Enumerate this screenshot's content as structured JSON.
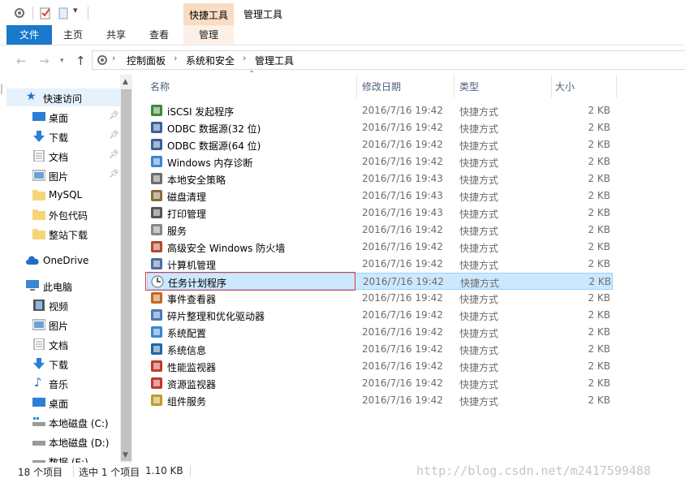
{
  "title_bar": {
    "contextual_tab_label": "快捷工具",
    "window_title": "管理工具"
  },
  "ribbon": {
    "tabs": [
      {
        "label": "文件",
        "active": true
      },
      {
        "label": "主页"
      },
      {
        "label": "共享"
      },
      {
        "label": "查看"
      },
      {
        "label": "管理"
      }
    ]
  },
  "address": {
    "breadcrumbs": [
      "控制面板",
      "系统和安全",
      "管理工具"
    ]
  },
  "nav_pane": {
    "items": [
      {
        "label": "快速访问",
        "icon": "star-icon"
      },
      {
        "label": "桌面",
        "icon": "desktop-icon",
        "pinned": true
      },
      {
        "label": "下载",
        "icon": "download-icon",
        "pinned": true
      },
      {
        "label": "文档",
        "icon": "documents-icon",
        "pinned": true
      },
      {
        "label": "图片",
        "icon": "pictures-icon",
        "pinned": true
      },
      {
        "label": "MySQL",
        "icon": "folder-icon"
      },
      {
        "label": "外包代码",
        "icon": "folder-icon"
      },
      {
        "label": "整站下载",
        "icon": "folder-icon"
      },
      {
        "label": "OneDrive",
        "icon": "cloud-icon"
      },
      {
        "label": "此电脑",
        "icon": "computer-icon"
      },
      {
        "label": "视频",
        "icon": "videos-icon"
      },
      {
        "label": "图片",
        "icon": "pictures-icon"
      },
      {
        "label": "文档",
        "icon": "documents-icon"
      },
      {
        "label": "下载",
        "icon": "download-icon"
      },
      {
        "label": "音乐",
        "icon": "music-icon"
      },
      {
        "label": "桌面",
        "icon": "desktop-icon"
      },
      {
        "label": "本地磁盘 (C:)",
        "icon": "drive-c-icon"
      },
      {
        "label": "本地磁盘 (D:)",
        "icon": "drive-icon"
      },
      {
        "label": "数据 (E:)",
        "icon": "drive-icon"
      }
    ]
  },
  "columns": {
    "name": "名称",
    "modified": "修改日期",
    "type": "类型",
    "size": "大小"
  },
  "files": [
    {
      "name": "iSCSI 发起程序",
      "date": "2016/7/16 19:42",
      "type": "快捷方式",
      "size": "2 KB"
    },
    {
      "name": "ODBC 数据源(32 位)",
      "date": "2016/7/16 19:42",
      "type": "快捷方式",
      "size": "2 KB"
    },
    {
      "name": "ODBC 数据源(64 位)",
      "date": "2016/7/16 19:42",
      "type": "快捷方式",
      "size": "2 KB"
    },
    {
      "name": "Windows 内存诊断",
      "date": "2016/7/16 19:42",
      "type": "快捷方式",
      "size": "2 KB"
    },
    {
      "name": "本地安全策略",
      "date": "2016/7/16 19:43",
      "type": "快捷方式",
      "size": "2 KB"
    },
    {
      "name": "磁盘清理",
      "date": "2016/7/16 19:43",
      "type": "快捷方式",
      "size": "2 KB"
    },
    {
      "name": "打印管理",
      "date": "2016/7/16 19:43",
      "type": "快捷方式",
      "size": "2 KB"
    },
    {
      "name": "服务",
      "date": "2016/7/16 19:42",
      "type": "快捷方式",
      "size": "2 KB"
    },
    {
      "name": "高级安全 Windows 防火墙",
      "date": "2016/7/16 19:42",
      "type": "快捷方式",
      "size": "2 KB"
    },
    {
      "name": "计算机管理",
      "date": "2016/7/16 19:42",
      "type": "快捷方式",
      "size": "2 KB"
    },
    {
      "name": "任务计划程序",
      "date": "2016/7/16 19:42",
      "type": "快捷方式",
      "size": "2 KB",
      "selected": true
    },
    {
      "name": "事件查看器",
      "date": "2016/7/16 19:42",
      "type": "快捷方式",
      "size": "2 KB"
    },
    {
      "name": "碎片整理和优化驱动器",
      "date": "2016/7/16 19:42",
      "type": "快捷方式",
      "size": "2 KB"
    },
    {
      "name": "系统配置",
      "date": "2016/7/16 19:42",
      "type": "快捷方式",
      "size": "2 KB"
    },
    {
      "name": "系统信息",
      "date": "2016/7/16 19:42",
      "type": "快捷方式",
      "size": "2 KB"
    },
    {
      "name": "性能监视器",
      "date": "2016/7/16 19:42",
      "type": "快捷方式",
      "size": "2 KB"
    },
    {
      "name": "资源监视器",
      "date": "2016/7/16 19:42",
      "type": "快捷方式",
      "size": "2 KB"
    },
    {
      "name": "组件服务",
      "date": "2016/7/16 19:42",
      "type": "快捷方式",
      "size": "2 KB"
    }
  ],
  "status": {
    "item_count": "18 个项目",
    "selection": "选中 1 个项目",
    "selection_size": "1.10 KB"
  },
  "watermark": "http://blog.csdn.net/m2417599488",
  "colors": {
    "accent": "#1979ca",
    "contextual_tab": "#f9dcc3",
    "selection_fill": "#cce8ff",
    "highlight_box": "#e23b3b"
  }
}
